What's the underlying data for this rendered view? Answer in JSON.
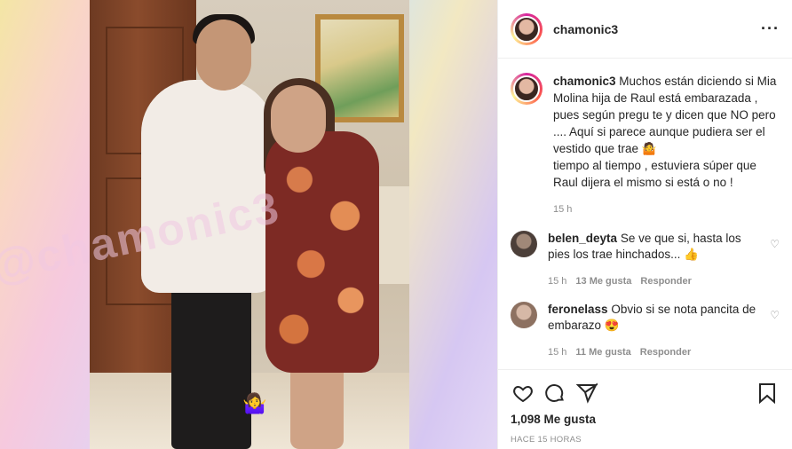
{
  "post": {
    "username": "chamonic3",
    "more_icon": "more-horizontal-icon",
    "watermark": "@chamonic3",
    "caption": {
      "username": "chamonic3",
      "text": "Muchos están diciendo si Mia Molina hija de Raul está embarazada , pues según pregu te y dicen que NO pero .... Aquí si parece aunque pudiera ser el vestido que trae 🤷",
      "text2": "tiempo al tiempo , estuviera súper que Raul dijera el mismo si está o no !",
      "time": "15 h"
    },
    "comments": [
      {
        "username": "belen_deyta",
        "text": "Se ve que si, hasta los pies los trae hinchados... 👍",
        "time": "15 h",
        "likes": "13 Me gusta",
        "reply": "Responder",
        "avatar_color": "#6b5a52"
      },
      {
        "username": "feronelass",
        "text": "Obvio si se nota pancita de embarazo 😍",
        "time": "15 h",
        "likes": "11 Me gusta",
        "reply": "Responder",
        "avatar_color": "#b49a8a"
      }
    ],
    "likes_count": "1,098 Me gusta",
    "time_ago": "HACE 15 HORAS"
  }
}
